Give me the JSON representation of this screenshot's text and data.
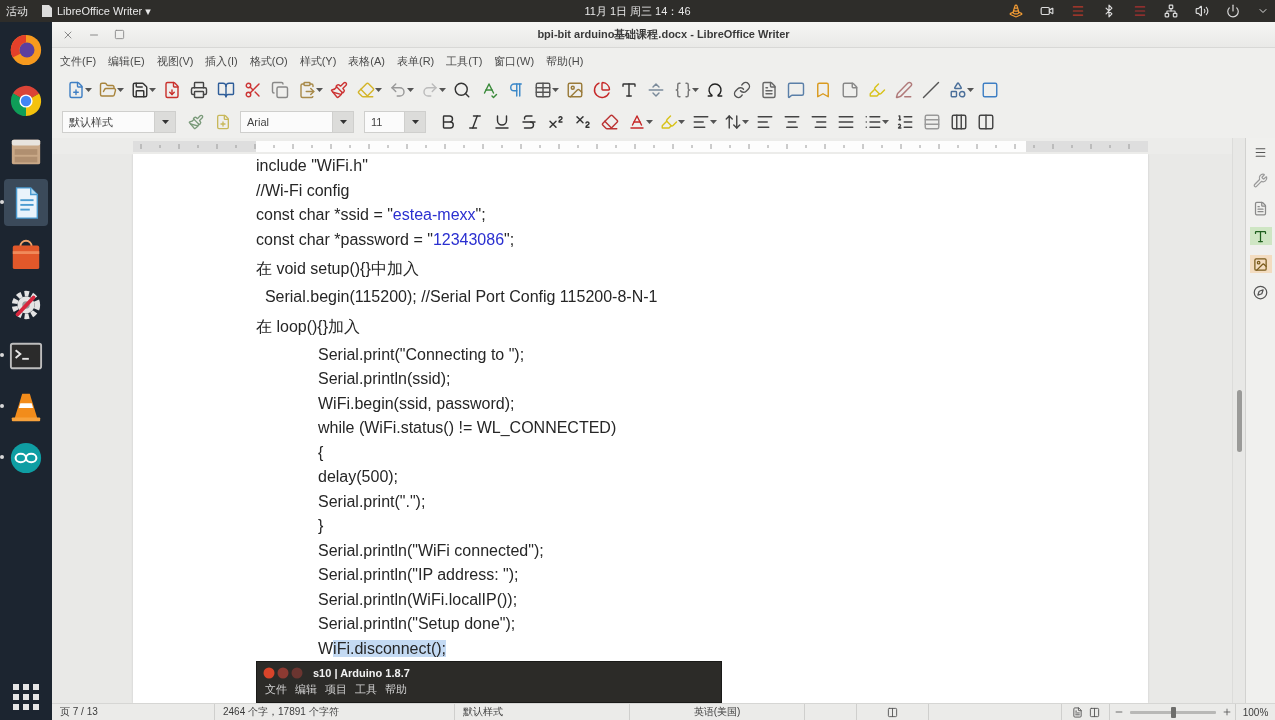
{
  "top_bar": {
    "activities": "活动",
    "app_menu": "LibreOffice Writer ▾",
    "clock": "11月 1日 周三 14：46"
  },
  "dock": [
    {
      "kind": "firefox",
      "running": false,
      "selected": false
    },
    {
      "kind": "chrome",
      "running": false,
      "selected": false
    },
    {
      "kind": "files",
      "running": false,
      "selected": false
    },
    {
      "kind": "writer",
      "running": true,
      "selected": true
    },
    {
      "kind": "software",
      "running": false,
      "selected": false
    },
    {
      "kind": "settings",
      "running": false,
      "selected": false
    },
    {
      "kind": "terminal",
      "running": true,
      "selected": false
    },
    {
      "kind": "vlc",
      "running": true,
      "selected": false
    },
    {
      "kind": "arduino",
      "running": true,
      "selected": false
    }
  ],
  "window": {
    "title": "bpi-bit arduino基础课程.docx - LibreOffice Writer"
  },
  "menu_bar": [
    "文件(F)",
    "编辑(E)",
    "视图(V)",
    "插入(I)",
    "格式(O)",
    "样式(Y)",
    "表格(A)",
    "表单(R)",
    "工具(T)",
    "窗口(W)",
    "帮助(H)"
  ],
  "formatting_toolbar": {
    "paragraph_style": "默认样式",
    "font_name": "Arial",
    "font_size": "11"
  },
  "document": {
    "lines": [
      {
        "kind": "code",
        "segments": [
          {
            "kind": "plain",
            "text": "include \"WiFi.h\""
          }
        ]
      },
      {
        "kind": "code",
        "segments": [
          {
            "kind": "plain",
            "text": "//Wi-Fi config"
          }
        ]
      },
      {
        "kind": "code",
        "segments": [
          {
            "kind": "plain",
            "text": "const char *ssid = \""
          },
          {
            "kind": "string",
            "text": "estea-mexx"
          },
          {
            "kind": "plain",
            "text": "\";"
          }
        ]
      },
      {
        "kind": "code",
        "segments": [
          {
            "kind": "plain",
            "text": "const char *password = \""
          },
          {
            "kind": "string",
            "text": "12343086"
          },
          {
            "kind": "plain",
            "text": "\";"
          }
        ]
      },
      {
        "kind": "note",
        "segments": [
          {
            "kind": "plain",
            "text": "在 void setup(){}中加入"
          }
        ]
      },
      {
        "kind": "code",
        "segments": [
          {
            "kind": "plain",
            "text": "  Serial.begin(115200); //Serial Port Config 115200-8-N-1"
          }
        ]
      },
      {
        "kind": "note",
        "segments": [
          {
            "kind": "plain",
            "text": "在 loop(){}加入"
          }
        ],
        "children": [
          {
            "kind": "code",
            "segments": [
              {
                "kind": "plain",
                "text": "Serial.print(\"Connecting to \");"
              }
            ]
          },
          {
            "kind": "code",
            "segments": [
              {
                "kind": "plain",
                "text": "Serial.println(ssid);"
              }
            ]
          },
          {
            "kind": "code",
            "segments": [
              {
                "kind": "plain",
                "text": "WiFi.begin(ssid, password);"
              }
            ]
          },
          {
            "kind": "code",
            "segments": [
              {
                "kind": "plain",
                "text": "while (WiFi.status() != WL_CONNECTED)"
              }
            ]
          },
          {
            "kind": "code",
            "segments": [
              {
                "kind": "plain",
                "text": "{"
              }
            ]
          },
          {
            "kind": "code",
            "segments": [
              {
                "kind": "plain",
                "text": "delay(500);"
              }
            ]
          },
          {
            "kind": "code",
            "segments": [
              {
                "kind": "plain",
                "text": "Serial.print(\".\");"
              }
            ]
          },
          {
            "kind": "code",
            "segments": [
              {
                "kind": "plain",
                "text": "}"
              }
            ]
          },
          {
            "kind": "code",
            "segments": [
              {
                "kind": "plain",
                "text": "Serial.println(\"WiFi connected\");"
              }
            ]
          },
          {
            "kind": "code",
            "segments": [
              {
                "kind": "plain",
                "text": "Serial.println(\"IP address: \");"
              }
            ]
          },
          {
            "kind": "code",
            "segments": [
              {
                "kind": "plain",
                "text": "Serial.println(WiFi.localIP());"
              }
            ]
          },
          {
            "kind": "code",
            "segments": [
              {
                "kind": "plain",
                "text": "Serial.println(\"Setup done\");"
              }
            ]
          },
          {
            "kind": "code",
            "segments": [
              {
                "kind": "plain",
                "text": "W"
              },
              {
                "kind": "selection",
                "text": "iFi.disconnect();"
              }
            ]
          }
        ]
      }
    ]
  },
  "overlay_window": {
    "title": "s10 | Arduino 1.8.7",
    "menu": [
      "文件",
      "编辑",
      "项目",
      "工具",
      "帮助"
    ]
  },
  "status_bar": {
    "page": "页 7 / 13",
    "word_count": "2464 个字，17891 个字符",
    "page_style": "默认样式",
    "language": "英语(美国)",
    "zoom": {
      "level": 0.5,
      "reading": "100%"
    }
  }
}
